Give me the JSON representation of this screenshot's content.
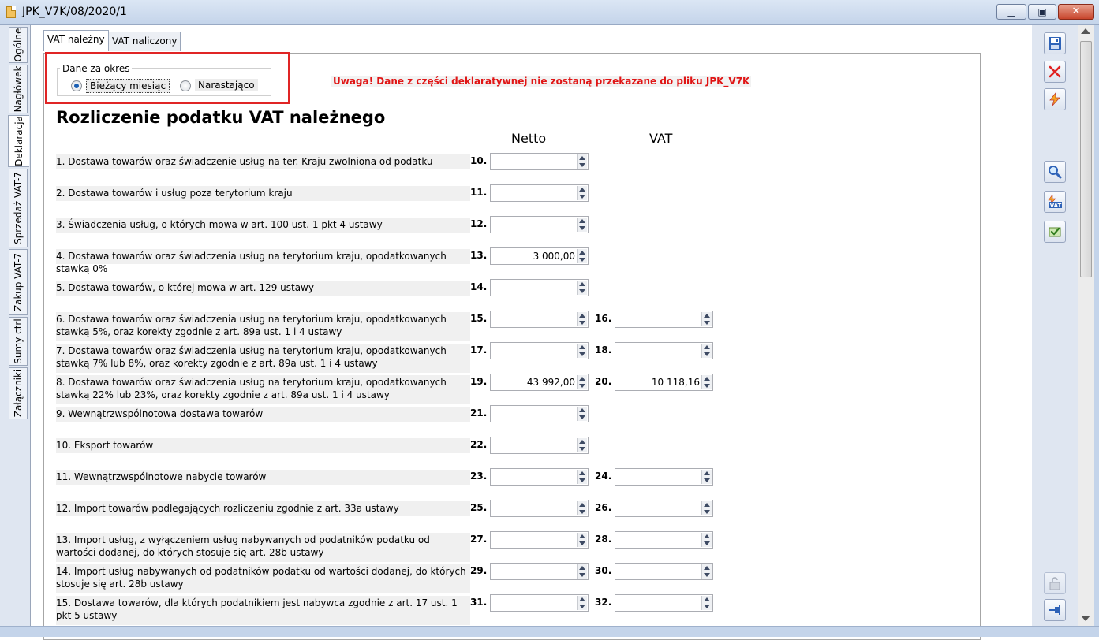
{
  "window": {
    "title": "JPK_V7K/08/2020/1",
    "minimize_glyph": "▁",
    "maximize_glyph": "▣",
    "close_glyph": "✕"
  },
  "left_tabs": [
    "Ogólne",
    "Nagłówek",
    "Deklaracja",
    "Sprzedaż VAT-7",
    "Zakup VAT-7",
    "Sumy ctrl",
    "Załączniki"
  ],
  "top_tabs": [
    "VAT należny",
    "VAT naliczony"
  ],
  "period": {
    "legend": "Dane za okres",
    "option_current": "Bieżący miesiąc",
    "option_cumulative": "Narastająco",
    "selected": "Bieżący miesiąc"
  },
  "warning": "Uwaga! Dane z części deklaratywnej nie zostaną przekazane do pliku JPK_V7K",
  "section_title": "Rozliczenie podatku VAT należnego",
  "col_netto": "Netto",
  "col_vat": "VAT",
  "rows": [
    {
      "desc": "1. Dostawa towarów oraz świadczenie usług na ter. Kraju zwolniona od podatku",
      "netto_no": "10.",
      "netto": ""
    },
    {
      "desc": "2. Dostawa towarów i usług poza terytorium kraju",
      "netto_no": "11.",
      "netto": ""
    },
    {
      "desc": "3. Świadczenia usług, o których mowa w art. 100 ust. 1 pkt 4 ustawy",
      "netto_no": "12.",
      "netto": ""
    },
    {
      "desc": "4. Dostawa towarów oraz świadczenia usług na terytorium kraju,  opodatkowanych stawką 0%",
      "netto_no": "13.",
      "netto": "3 000,00"
    },
    {
      "desc": "5. Dostawa towarów, o której mowa w art. 129 ustawy",
      "netto_no": "14.",
      "netto": ""
    },
    {
      "desc": "6. Dostawa towarów oraz świadczenia usług na terytorium kraju, opodatkowanych stawką 5%, oraz korekty zgodnie z art. 89a ust. 1 i 4 ustawy",
      "netto_no": "15.",
      "netto": "",
      "vat_no": "16.",
      "vat": ""
    },
    {
      "desc": "7. Dostawa towarów oraz świadczenia usług na terytorium kraju, opodatkowanych stawką 7% lub 8%, oraz korekty zgodnie z art. 89a ust. 1 i 4 ustawy",
      "netto_no": "17.",
      "netto": "",
      "vat_no": "18.",
      "vat": ""
    },
    {
      "desc": "8. Dostawa towarów oraz świadczenia usług na terytorium kraju, opodatkowanych stawką 22% lub 23%, oraz korekty zgodnie z art. 89a ust. 1 i 4 ustawy",
      "netto_no": "19.",
      "netto": "43 992,00",
      "vat_no": "20.",
      "vat": "10 118,16"
    },
    {
      "desc": "9. Wewnątrzwspólnotowa dostawa towarów",
      "netto_no": "21.",
      "netto": ""
    },
    {
      "desc": "10. Eksport towarów",
      "netto_no": "22.",
      "netto": ""
    },
    {
      "desc": "11. Wewnątrzwspólnotowe nabycie towarów",
      "netto_no": "23.",
      "netto": "",
      "vat_no": "24.",
      "vat": ""
    },
    {
      "desc": "12. Import towarów podlegających rozliczeniu zgodnie z art. 33a ustawy",
      "netto_no": "25.",
      "netto": "",
      "vat_no": "26.",
      "vat": ""
    },
    {
      "desc": "13. Import usług, z wyłączeniem usług nabywanych od podatników podatku od wartości dodanej, do których stosuje się art. 28b ustawy",
      "netto_no": "27.",
      "netto": "",
      "vat_no": "28.",
      "vat": ""
    },
    {
      "desc": "14. Import usług nabywanych od podatników podatku od wartości dodanej, do których stosuje się art. 28b ustawy",
      "netto_no": "29.",
      "netto": "",
      "vat_no": "30.",
      "vat": ""
    },
    {
      "desc": "15. Dostawa towarów, dla których podatnikiem jest nabywca zgodnie z art. 17 ust. 1 pkt 5 ustawy",
      "netto_no": "31.",
      "netto": "",
      "vat_no": "32.",
      "vat": ""
    }
  ],
  "toolbar": {
    "save_icon": "floppy-disk-icon",
    "cancel_icon": "red-x-icon",
    "lightning_icon": "lightning-icon",
    "preview_icon": "magnifier-icon",
    "vat_icon": "vat-lightning-icon",
    "check_icon": "green-check-icon",
    "lock_icon": "padlock-icon",
    "pin_icon": "pin-icon",
    "vat_badge": "VAT"
  },
  "colors": {
    "warning": "#e01515",
    "highlight_box": "#e02525",
    "row_bg": "#f0f0f0"
  }
}
